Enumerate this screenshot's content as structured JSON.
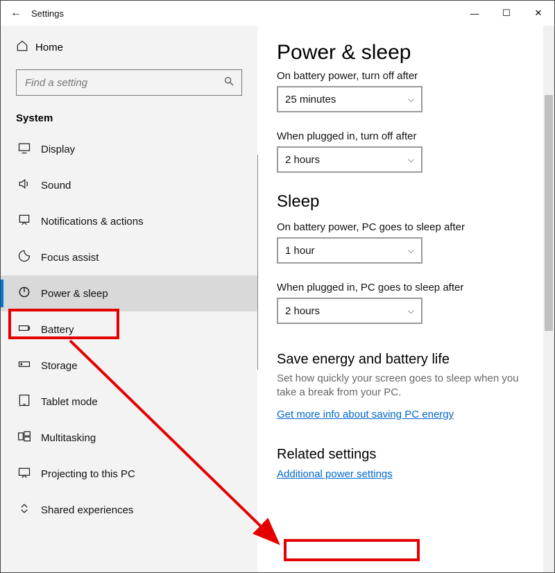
{
  "window": {
    "title": "Settings",
    "minimize": "—",
    "maximize": "☐",
    "close": "✕"
  },
  "sidebar": {
    "home_label": "Home",
    "search_placeholder": "Find a setting",
    "section_label": "System",
    "items": [
      {
        "label": "Display"
      },
      {
        "label": "Sound"
      },
      {
        "label": "Notifications & actions"
      },
      {
        "label": "Focus assist"
      },
      {
        "label": "Power & sleep"
      },
      {
        "label": "Battery"
      },
      {
        "label": "Storage"
      },
      {
        "label": "Tablet mode"
      },
      {
        "label": "Multitasking"
      },
      {
        "label": "Projecting to this PC"
      },
      {
        "label": "Shared experiences"
      }
    ]
  },
  "main": {
    "title": "Power & sleep",
    "screen_cut_label": "On battery power, turn off after",
    "screen_battery_value": "25 minutes",
    "screen_plugged_label": "When plugged in, turn off after",
    "screen_plugged_value": "2 hours",
    "sleep_heading": "Sleep",
    "sleep_battery_label": "On battery power, PC goes to sleep after",
    "sleep_battery_value": "1 hour",
    "sleep_plugged_label": "When plugged in, PC goes to sleep after",
    "sleep_plugged_value": "2 hours",
    "energy_heading": "Save energy and battery life",
    "energy_help": "Set how quickly your screen goes to sleep when you take a break from your PC.",
    "energy_link": "Get more info about saving PC energy",
    "related_heading": "Related settings",
    "related_link": "Additional power settings"
  }
}
